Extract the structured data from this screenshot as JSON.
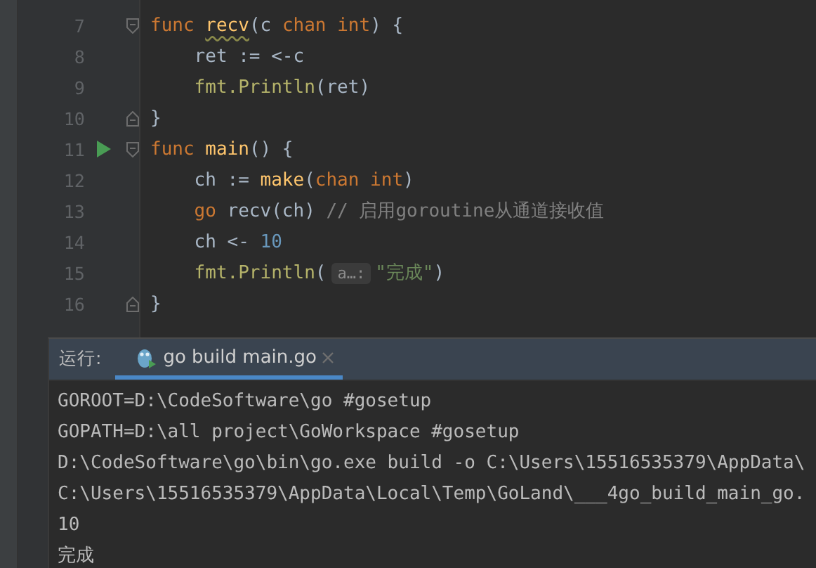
{
  "editor": {
    "lines": [
      {
        "number": "7",
        "run": false,
        "fold_start": true,
        "fold_end": false,
        "indented": false,
        "tokens": [
          {
            "kind": "keyword",
            "text": "func "
          },
          {
            "kind": "warn-name",
            "text": "recv"
          },
          {
            "kind": "plain",
            "text": "(c "
          },
          {
            "kind": "keyword",
            "text": "chan int"
          },
          {
            "kind": "plain",
            "text": ") {"
          }
        ]
      },
      {
        "number": "8",
        "run": false,
        "fold_start": false,
        "fold_end": false,
        "indented": true,
        "tokens": [
          {
            "kind": "plain",
            "text": "ret := <-c"
          }
        ]
      },
      {
        "number": "9",
        "run": false,
        "fold_start": false,
        "fold_end": false,
        "indented": true,
        "tokens": [
          {
            "kind": "call",
            "text": "fmt.Println"
          },
          {
            "kind": "plain",
            "text": "(ret)"
          }
        ]
      },
      {
        "number": "10",
        "run": false,
        "fold_start": false,
        "fold_end": true,
        "indented": false,
        "tokens": [
          {
            "kind": "plain",
            "text": "}"
          }
        ]
      },
      {
        "number": "11",
        "run": true,
        "fold_start": true,
        "fold_end": false,
        "indented": false,
        "tokens": [
          {
            "kind": "keyword",
            "text": "func "
          },
          {
            "kind": "name",
            "text": "main"
          },
          {
            "kind": "plain",
            "text": "() {"
          }
        ]
      },
      {
        "number": "12",
        "run": false,
        "fold_start": false,
        "fold_end": false,
        "indented": true,
        "tokens": [
          {
            "kind": "plain",
            "text": "ch := "
          },
          {
            "kind": "name",
            "text": "make"
          },
          {
            "kind": "plain",
            "text": "("
          },
          {
            "kind": "keyword",
            "text": "chan int"
          },
          {
            "kind": "plain",
            "text": ")"
          }
        ]
      },
      {
        "number": "13",
        "run": false,
        "fold_start": false,
        "fold_end": false,
        "indented": true,
        "tokens": [
          {
            "kind": "keyword",
            "text": "go "
          },
          {
            "kind": "plain",
            "text": "recv(ch) "
          },
          {
            "kind": "comment",
            "text": "// 启用goroutine从通道接收值"
          }
        ]
      },
      {
        "number": "14",
        "run": false,
        "fold_start": false,
        "fold_end": false,
        "indented": true,
        "tokens": [
          {
            "kind": "plain",
            "text": "ch <- "
          },
          {
            "kind": "number",
            "text": "10"
          }
        ]
      },
      {
        "number": "15",
        "run": false,
        "fold_start": false,
        "fold_end": false,
        "indented": true,
        "tokens": [
          {
            "kind": "call",
            "text": "fmt.Println"
          },
          {
            "kind": "plain",
            "text": "("
          },
          {
            "kind": "hint",
            "text": "a…:"
          },
          {
            "kind": "string",
            "text": "\"完成\""
          },
          {
            "kind": "plain",
            "text": ")"
          }
        ]
      },
      {
        "number": "16",
        "run": false,
        "fold_start": false,
        "fold_end": true,
        "indented": false,
        "tokens": [
          {
            "kind": "plain",
            "text": "}"
          }
        ]
      }
    ]
  },
  "run_panel": {
    "label": "运行:",
    "tabs": [
      {
        "title": "go build main.go",
        "selected": true
      }
    ],
    "output": [
      "GOROOT=D:\\CodeSoftware\\go #gosetup",
      "GOPATH=D:\\all project\\GoWorkspace #gosetup",
      "D:\\CodeSoftware\\go\\bin\\go.exe build -o C:\\Users\\15516535379\\AppData\\",
      "C:\\Users\\15516535379\\AppData\\Local\\Temp\\GoLand\\___4go_build_main_go.",
      "10",
      "完成"
    ]
  }
}
